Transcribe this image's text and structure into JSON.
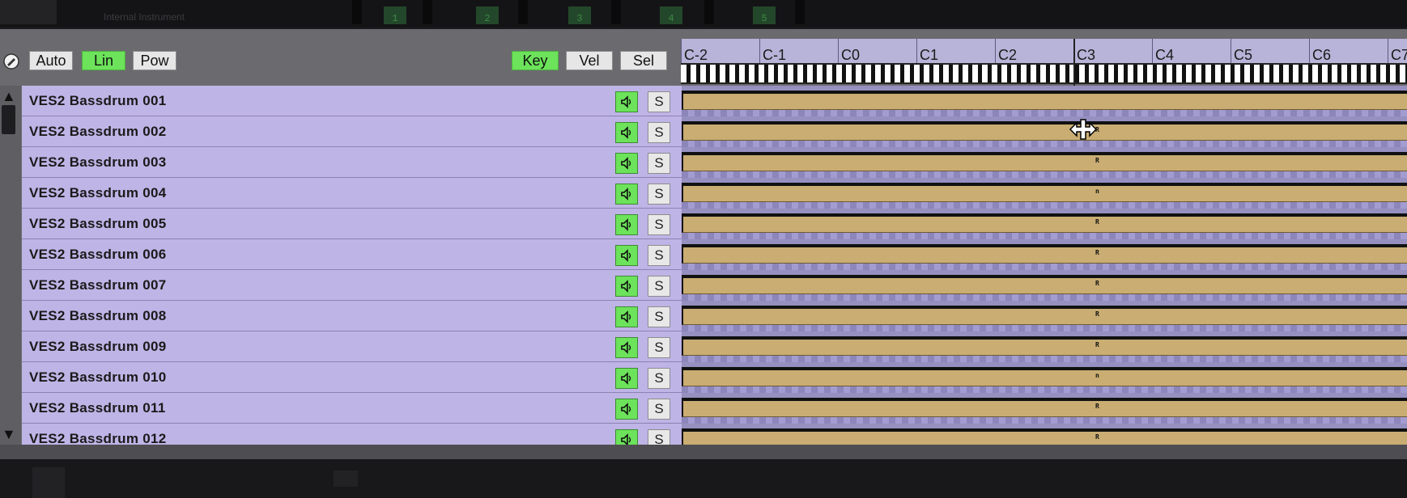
{
  "toolbar": {
    "auto_label": "Auto",
    "lin_label": "Lin",
    "pow_label": "Pow",
    "key_label": "Key",
    "vel_label": "Vel",
    "sel_label": "Sel"
  },
  "top_indicators": [
    "1",
    "2",
    "3",
    "4",
    "5"
  ],
  "top_faint_text": "Internal Instrument",
  "keyboard": {
    "octaves": [
      "C-2",
      "C-1",
      "C0",
      "C1",
      "C2",
      "C3",
      "C4",
      "C5",
      "C6",
      "C7"
    ]
  },
  "tracks": [
    {
      "name": "VES2 Bassdrum 001",
      "marker": ""
    },
    {
      "name": "VES2 Bassdrum 002",
      "marker": "R"
    },
    {
      "name": "VES2 Bassdrum 003",
      "marker": "R"
    },
    {
      "name": "VES2 Bassdrum 004",
      "marker": "n"
    },
    {
      "name": "VES2 Bassdrum 005",
      "marker": "R"
    },
    {
      "name": "VES2 Bassdrum 006",
      "marker": "R"
    },
    {
      "name": "VES2 Bassdrum 007",
      "marker": "R"
    },
    {
      "name": "VES2 Bassdrum 008",
      "marker": "R"
    },
    {
      "name": "VES2 Bassdrum 009",
      "marker": "R"
    },
    {
      "name": "VES2 Bassdrum 010",
      "marker": "n"
    },
    {
      "name": "VES2 Bassdrum 011",
      "marker": "R"
    },
    {
      "name": "VES2 Bassdrum 012",
      "marker": "R"
    }
  ],
  "track_buttons": {
    "solo_label": "S"
  },
  "icons": {
    "logo": "edit-circle-icon",
    "mute": "speaker-icon",
    "scroll_up": "triangle-up-icon",
    "scroll_down": "triangle-down-icon",
    "cursor": "horizontal-resize-cursor-icon"
  },
  "colors": {
    "active_green": "#6ce35a",
    "track_header": "#bfb4e6",
    "note_fill": "#c9ad72",
    "ruler": "#b8b3d8"
  }
}
